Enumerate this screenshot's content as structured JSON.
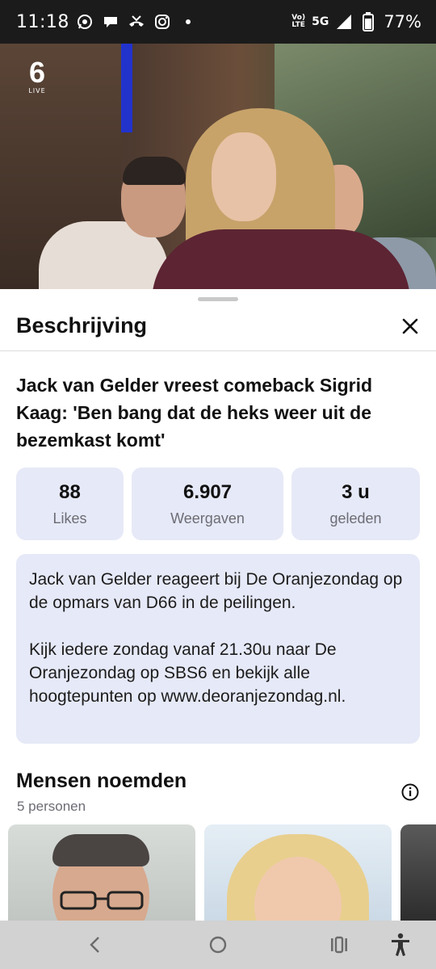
{
  "status_bar": {
    "time": "11:18",
    "network_top": "Vo)",
    "network_bottom": "LTE",
    "signal_type": "5G",
    "battery": "77%",
    "left_icons": [
      "whatsapp-icon",
      "chat-icon",
      "missed-call-icon",
      "instagram-icon",
      "dot-icon"
    ]
  },
  "video": {
    "channel_number": "6",
    "channel_tag": "LIVE"
  },
  "sheet": {
    "title": "Beschrijving",
    "headline": "Jack van Gelder vreest comeback Sigrid Kaag: 'Ben bang dat de heks weer uit de bezemkast komt'",
    "stats": [
      {
        "value": "88",
        "label": "Likes"
      },
      {
        "value": "6.907",
        "label": "Weergaven"
      },
      {
        "value": "3 u",
        "label": "geleden"
      }
    ],
    "description": [
      "Jack van Gelder reageert bij De Oranjezondag op de opmars van D66 in de peilingen.",
      "Kijk iedere zondag vanaf 21.30u naar De Oranjezondag op SBS6 en bekijk alle hoogtepunten op www.deoranjezondag.nl."
    ],
    "people": {
      "title": "Mensen noemden",
      "count": "5 personen"
    }
  },
  "colors": {
    "card_bg": "#e6e9f7",
    "status_bg": "#1b1b1b",
    "nav_bg": "#d2d2d2"
  },
  "nav": [
    "back-icon",
    "home-icon",
    "recents-icon",
    "accessibility-icon"
  ]
}
